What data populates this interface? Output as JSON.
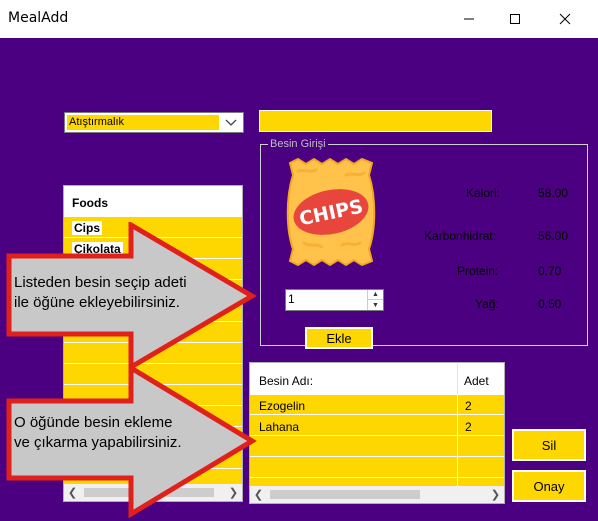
{
  "window": {
    "title": "MealAdd"
  },
  "category": {
    "selected": "Atıştırmalık"
  },
  "food_group": {
    "legend": "Besin Girişi"
  },
  "food_image": {
    "label": "CHIPS"
  },
  "nutrition": [
    {
      "label": "Kalori:",
      "value": "58.00"
    },
    {
      "label": "Karbonhidrat:",
      "value": "56.00"
    },
    {
      "label": "Protein:",
      "value": "0.70"
    },
    {
      "label": "Yağ:",
      "value": "0.50"
    }
  ],
  "quantity": {
    "value": "1"
  },
  "buttons": {
    "add": "Ekle",
    "delete": "Sil",
    "confirm": "Onay"
  },
  "foods_list": {
    "header": "Foods",
    "items": [
      "Cips",
      "Çikolata"
    ]
  },
  "meal_list": {
    "columns": [
      "Besin Adı:",
      "Adet"
    ],
    "rows": [
      {
        "name": "Ezogelin",
        "count": "2"
      },
      {
        "name": "Lahana",
        "count": "2"
      }
    ]
  },
  "callouts": {
    "top": [
      "Listeden besin seçip adeti",
      "ile öğüne ekleyebilirsiniz."
    ],
    "bottom": [
      "O öğünde besin ekleme",
      "ve çıkarma yapabilirsiniz."
    ]
  },
  "colors": {
    "background": "#4B0082",
    "accent": "#FFD700",
    "callout_border": "#E0201A",
    "callout_fill": "#C8C8C8"
  }
}
